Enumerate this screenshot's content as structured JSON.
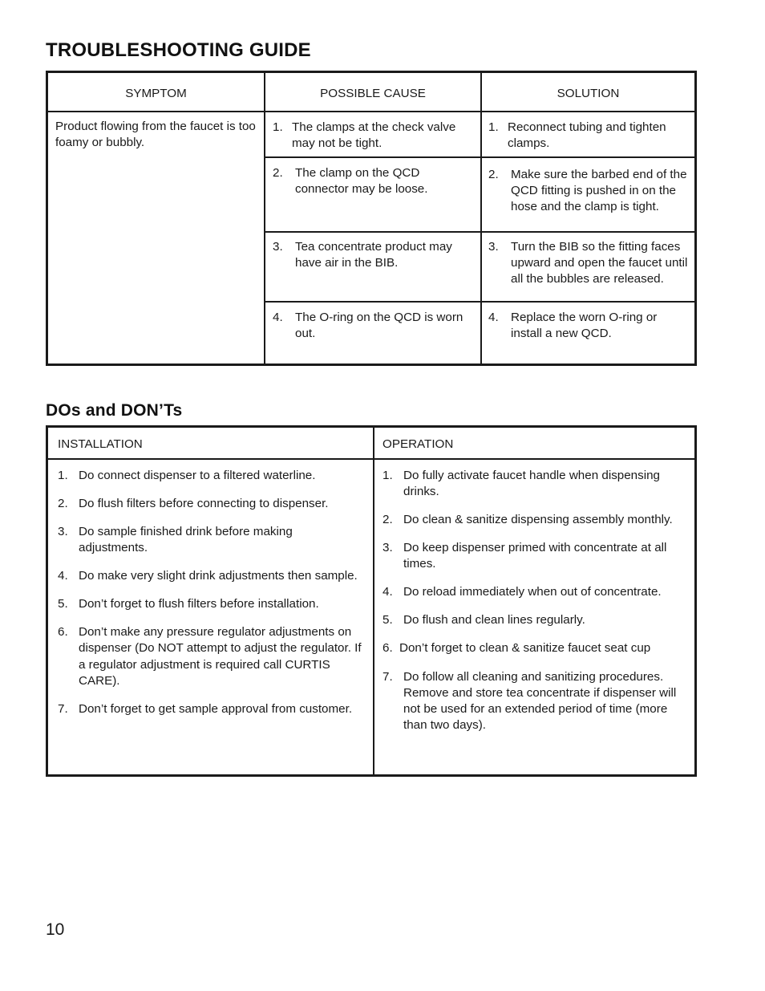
{
  "page": {
    "number": "10"
  },
  "troubleshooting": {
    "heading": "TROUBLESHOOTING GUIDE",
    "columns": {
      "symptom": "SYMPTOM",
      "possible_cause": "POSSIBLE CAUSE",
      "solution": "SOLUTION"
    },
    "symptom": "Product flowing from the faucet is too foamy or bubbly.",
    "rows": [
      {
        "num": "1.",
        "cause": "The clamps at the check valve may not be tight.",
        "solution_num": "1.",
        "solution": "Reconnect tubing and tighten clamps."
      },
      {
        "num": "2.",
        "cause": "The clamp on the QCD connector may be loose.",
        "solution_num": "2.",
        "solution": "Make sure the barbed end of the QCD fitting is pushed in on the hose and the clamp is tight."
      },
      {
        "num": "3.",
        "cause": "Tea concentrate product may have air in the BIB.",
        "solution_num": "3.",
        "solution": "Turn the BIB so the fitting faces upward and open the faucet until all the bubbles are released."
      },
      {
        "num": "4.",
        "cause": "The O-ring on the QCD is worn out.",
        "solution_num": "4.",
        "solution": "Replace the worn O-ring or install a new QCD."
      }
    ]
  },
  "dos_and_donts": {
    "heading": "DOs and DON’Ts",
    "columns": {
      "installation": "INSTALLATION",
      "operation": "OPERATION"
    },
    "installation": [
      {
        "num": "1.",
        "text": "Do connect dispenser to a filtered waterline."
      },
      {
        "num": "2.",
        "text": "Do flush filters before connecting to dispenser."
      },
      {
        "num": "3.",
        "text": "Do sample finished drink before making adjustments."
      },
      {
        "num": "4.",
        "text": "Do make very slight drink adjustments then sample."
      },
      {
        "num": "5.",
        "text": "Don’t forget to flush filters before installation."
      },
      {
        "num": "6.",
        "text": "Don’t make any pressure regulator adjustments on dispenser (Do NOT attempt to adjust the regulator. If a regulator adjustment is required call CURTIS CARE)."
      },
      {
        "num": "7.",
        "text": "Don’t forget to get sample approval from customer."
      }
    ],
    "operation": [
      {
        "num": "1.",
        "text": "Do fully activate faucet handle when dispensing drinks."
      },
      {
        "num": "2.",
        "text": "Do clean & sanitize dispensing assembly monthly."
      },
      {
        "num": "3.",
        "text": "Do keep dispenser primed with concentrate at all times."
      },
      {
        "num": "4.",
        "text": "Do reload immediately when out of concentrate."
      },
      {
        "num": "5.",
        "text": "Do flush and clean lines regularly."
      },
      {
        "num": "6.",
        "text": "Don’t forget to clean & sanitize faucet seat cup"
      },
      {
        "num": "7.",
        "text": "Do follow all cleaning and sanitizing procedures. Remove and store tea concentrate if dispenser will not be used for an extended period of time (more than two days)."
      }
    ]
  }
}
